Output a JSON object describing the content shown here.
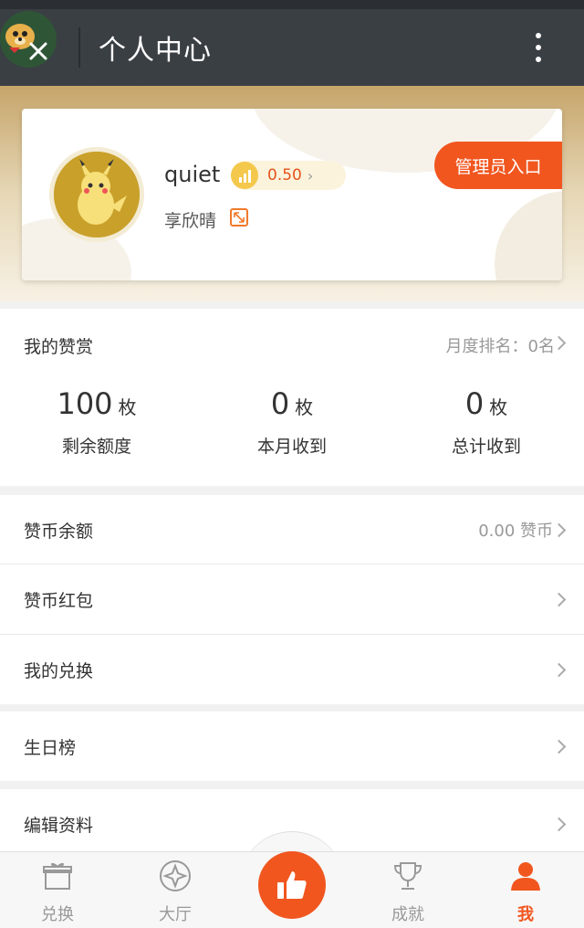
{
  "header": {
    "title": "个人中心",
    "logo_icon": "mascot-logo-icon",
    "more_icon": "more-vertical-icon"
  },
  "profile": {
    "username": "quiet",
    "level_value": "0.50",
    "level_arrow": "›",
    "real_name": "享欣晴",
    "admin_button": "管理员入口",
    "avatar_icon": "pikachu-avatar",
    "accent_color": "#f1561f"
  },
  "zan": {
    "title": "我的赞赏",
    "rank": "月度排名：0名",
    "stats": [
      {
        "value": "100",
        "unit": "枚",
        "label": "剩余额度"
      },
      {
        "value": "0",
        "unit": "枚",
        "label": "本月收到"
      },
      {
        "value": "0",
        "unit": "枚",
        "label": "总计收到"
      }
    ]
  },
  "menu": [
    {
      "label": "赞币余额",
      "value": "0.00 赞币"
    },
    {
      "label": "赞币红包",
      "value": ""
    },
    {
      "label": "我的兑换",
      "value": ""
    },
    {
      "label": "生日榜",
      "value": ""
    },
    {
      "label": "编辑资料",
      "value": ""
    }
  ],
  "tabs": [
    {
      "label": "兑换",
      "icon": "gift-icon"
    },
    {
      "label": "大厅",
      "icon": "compass-icon"
    },
    {
      "label": "",
      "icon": "thumbs-up-icon"
    },
    {
      "label": "成就",
      "icon": "trophy-icon"
    },
    {
      "label": "我",
      "icon": "person-icon",
      "active": true
    }
  ]
}
